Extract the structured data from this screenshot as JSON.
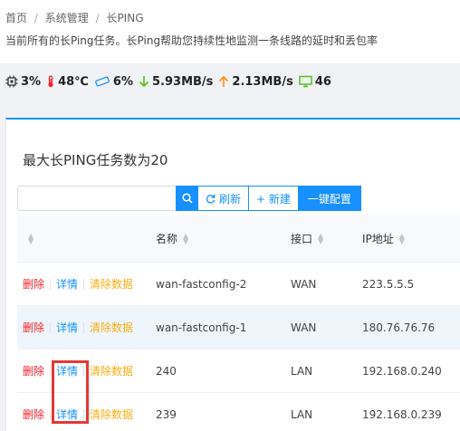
{
  "breadcrumb": {
    "home": "首页",
    "system": "系统管理",
    "current": "长PING",
    "separator": "/"
  },
  "page_description": "当前所有的长Ping任务。长Ping帮助您持续性地监测一条线路的延时和丢包率",
  "stats": {
    "cpu": "3%",
    "temperature": "48℃",
    "memory": "6%",
    "download": "5.93MB/s",
    "upload": "2.13MB/s",
    "online": "46"
  },
  "card": {
    "title": "最大长PING任务数为20"
  },
  "toolbar": {
    "search_placeholder": "",
    "refresh_label": "刷新",
    "new_label": "+ 新建",
    "one_click_label": "一键配置"
  },
  "table": {
    "columns": {
      "name": "名称",
      "interface": "接口",
      "ip": "IP地址"
    },
    "actions": {
      "delete": "删除",
      "details": "详情",
      "clear": "清除数据"
    },
    "rows": [
      {
        "name": "wan-fastconfig-2",
        "interface": "WAN",
        "ip": "223.5.5.5"
      },
      {
        "name": "wan-fastconfig-1",
        "interface": "WAN",
        "ip": "180.76.76.76"
      },
      {
        "name": "240",
        "interface": "LAN",
        "ip": "192.168.0.240"
      },
      {
        "name": "239",
        "interface": "LAN",
        "ip": "192.168.0.239"
      }
    ]
  },
  "colors": {
    "accent": "#1890ff",
    "danger": "#f5222d",
    "warning": "#faad14",
    "success": "#52c41a",
    "highlight": "#e53935"
  }
}
